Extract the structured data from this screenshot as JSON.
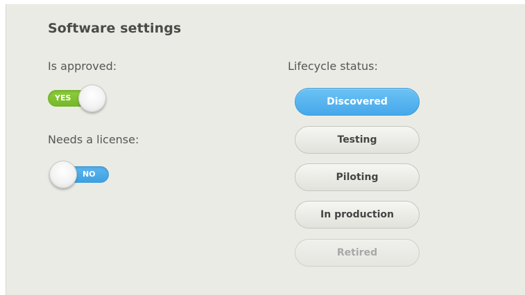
{
  "panel": {
    "title": "Software settings"
  },
  "approved": {
    "label": "Is approved:",
    "toggle_text": "YES",
    "state": "on",
    "color": "#7cc232"
  },
  "license": {
    "label": "Needs a license:",
    "toggle_text": "NO",
    "state": "off",
    "color": "#4aa8e8"
  },
  "lifecycle": {
    "label": "Lifecycle status:",
    "options": [
      {
        "label": "Discovered",
        "state": "selected"
      },
      {
        "label": "Testing",
        "state": "normal"
      },
      {
        "label": "Piloting",
        "state": "normal"
      },
      {
        "label": "In production",
        "state": "normal"
      },
      {
        "label": "Retired",
        "state": "disabled"
      }
    ]
  }
}
